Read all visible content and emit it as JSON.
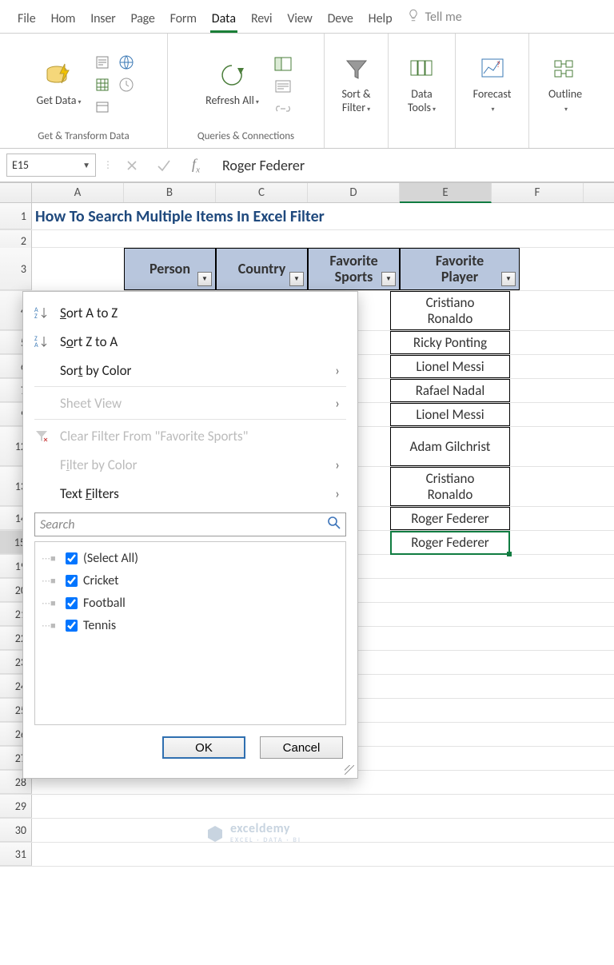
{
  "ribbon_tabs": {
    "file": "File",
    "home": "Hom",
    "insert": "Inser",
    "page": "Page",
    "formulas": "Form",
    "data": "Data",
    "review": "Revi",
    "view": "View",
    "developer": "Deve",
    "help": "Help",
    "tellme": "Tell me"
  },
  "ribbon_groups": {
    "get_transform": {
      "label": "Get & Transform Data",
      "get_data": "Get\nData"
    },
    "queries": {
      "label": "Queries & Connections",
      "refresh_all": "Refresh\nAll"
    },
    "sort_filter": {
      "label": "",
      "btn": "Sort &\nFilter"
    },
    "data_tools": {
      "label": "",
      "btn": "Data\nTools"
    },
    "forecast": {
      "label": "",
      "btn": "Forecast"
    },
    "outline": {
      "label": "",
      "btn": "Outline"
    }
  },
  "namebox": "E15",
  "formula_value": "Roger Federer",
  "columns": [
    "A",
    "B",
    "C",
    "D",
    "E",
    "F"
  ],
  "row_headers": [
    "1",
    "2",
    "3",
    "4",
    "5",
    "6",
    "7",
    "9",
    "12",
    "13",
    "14",
    "15",
    "19",
    "20",
    "21",
    "22",
    "23",
    "24",
    "25",
    "26",
    "27",
    "28",
    "29",
    "30",
    "31"
  ],
  "title_text": "How To Search Multiple Items In Excel Filter",
  "table_headers": {
    "person": "Person",
    "country": "Country",
    "favorite_sports": "Favorite\nSports",
    "favorite_player": "Favorite\nPlayer"
  },
  "favorite_player_values": [
    "Cristiano\nRonaldo",
    "Ricky Ponting",
    "Lionel Messi",
    "Rafael Nadal",
    "Lionel Messi",
    "Adam Gilchrist",
    "Cristiano\nRonaldo",
    "Roger Federer",
    "Roger Federer"
  ],
  "filter_menu": {
    "sort_az": "Sort A to Z",
    "sort_za": "Sort Z to A",
    "sort_color": "Sort by Color",
    "sheet_view": "Sheet View",
    "clear_filter": "Clear Filter From \"Favorite Sports\"",
    "filter_color": "Filter by Color",
    "text_filters": "Text Filters",
    "search_placeholder": "Search",
    "select_all": "(Select All)",
    "options": [
      "Cricket",
      "Football",
      "Tennis"
    ],
    "ok": "OK",
    "cancel": "Cancel"
  },
  "watermark": {
    "brand": "exceldemy",
    "tag": "EXCEL · DATA · BI"
  }
}
